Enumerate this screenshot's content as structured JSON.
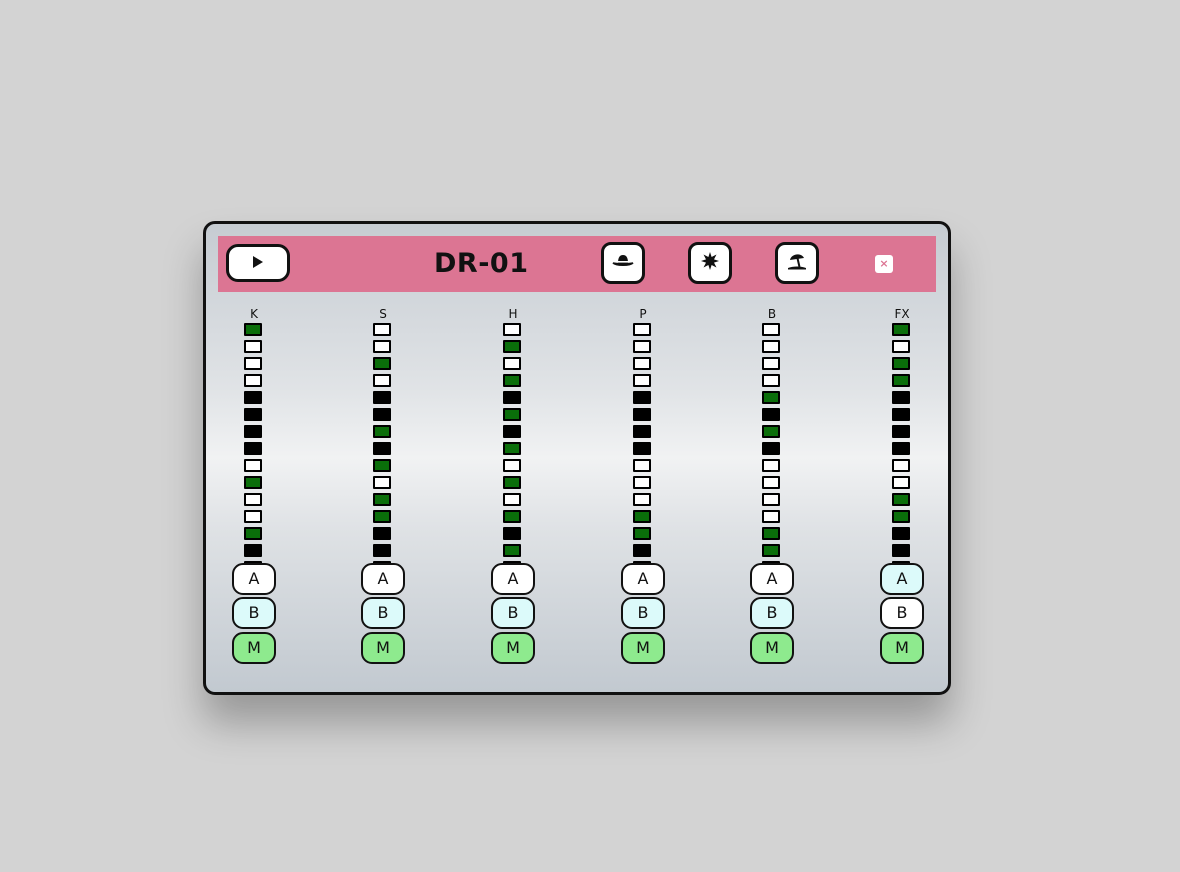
{
  "app": {
    "title": "DR-01",
    "close_label": "×"
  },
  "header": {
    "play_icon": "play-icon",
    "kit_buttons": [
      {
        "icon": "hat-icon"
      },
      {
        "icon": "splat-icon"
      },
      {
        "icon": "beach-umbrella-icon"
      }
    ]
  },
  "colors": {
    "header": "#dc7593",
    "step_on": "#0a6e0a",
    "step_off": "#ffffff",
    "step_muted": "#000000",
    "button_white": "#ffffff",
    "button_cyan": "#dcfafa",
    "button_mute_green": "#8eea8e"
  },
  "tracks": [
    {
      "label": "K",
      "steps": [
        "on",
        "off",
        "off",
        "off",
        "blk",
        "blk",
        "blk",
        "blk",
        "off",
        "on",
        "off",
        "off",
        "on",
        "blk",
        "on",
        "blk"
      ],
      "buttons": [
        {
          "label": "A",
          "color": "white"
        },
        {
          "label": "B",
          "color": "cyan"
        },
        {
          "label": "M",
          "color": "green"
        }
      ]
    },
    {
      "label": "S",
      "steps": [
        "off",
        "off",
        "on",
        "off",
        "blk",
        "blk",
        "on",
        "blk",
        "on",
        "off",
        "on",
        "on",
        "blk",
        "blk",
        "on",
        "blk"
      ],
      "buttons": [
        {
          "label": "A",
          "color": "white"
        },
        {
          "label": "B",
          "color": "cyan"
        },
        {
          "label": "M",
          "color": "green"
        }
      ]
    },
    {
      "label": "H",
      "steps": [
        "off",
        "on",
        "off",
        "on",
        "blk",
        "on",
        "blk",
        "on",
        "off",
        "on",
        "off",
        "on",
        "blk",
        "on",
        "blk",
        "blk"
      ],
      "buttons": [
        {
          "label": "A",
          "color": "white"
        },
        {
          "label": "B",
          "color": "cyan"
        },
        {
          "label": "M",
          "color": "green"
        }
      ]
    },
    {
      "label": "P",
      "steps": [
        "off",
        "off",
        "off",
        "off",
        "blk",
        "blk",
        "blk",
        "blk",
        "off",
        "off",
        "off",
        "on",
        "on",
        "blk",
        "blk",
        "blk"
      ],
      "buttons": [
        {
          "label": "A",
          "color": "white"
        },
        {
          "label": "B",
          "color": "cyan"
        },
        {
          "label": "M",
          "color": "green"
        }
      ]
    },
    {
      "label": "B",
      "steps": [
        "off",
        "off",
        "off",
        "off",
        "on",
        "blk",
        "on",
        "blk",
        "off",
        "off",
        "off",
        "off",
        "on",
        "on",
        "on",
        "blk"
      ],
      "buttons": [
        {
          "label": "A",
          "color": "white"
        },
        {
          "label": "B",
          "color": "cyan"
        },
        {
          "label": "M",
          "color": "green"
        }
      ]
    },
    {
      "label": "FX",
      "steps": [
        "on",
        "off",
        "on",
        "on",
        "blk",
        "blk",
        "blk",
        "blk",
        "off",
        "off",
        "on",
        "on",
        "blk",
        "blk",
        "blk",
        "blk"
      ],
      "buttons": [
        {
          "label": "A",
          "color": "cyan"
        },
        {
          "label": "B",
          "color": "white"
        },
        {
          "label": "M",
          "color": "green"
        }
      ]
    }
  ]
}
